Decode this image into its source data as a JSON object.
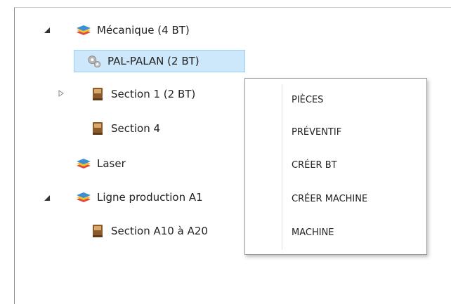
{
  "tree": {
    "nodes": [
      {
        "label": "Mécanique (4 BT)",
        "icon": "layers-icon",
        "expander": "expanded"
      },
      {
        "label": "PAL-PALAN (2 BT)",
        "icon": "gears-icon",
        "selected": true
      },
      {
        "label": "Section 1 (2 BT)",
        "icon": "book-icon",
        "expander": "collapsed"
      },
      {
        "label": "Section 4",
        "icon": "book-icon"
      },
      {
        "label": "Laser",
        "icon": "layers-icon"
      },
      {
        "label": "Ligne production A1",
        "icon": "layers-icon",
        "expander": "expanded"
      },
      {
        "label": "Section A10 à A20",
        "icon": "book-icon"
      }
    ]
  },
  "context_menu": {
    "items": [
      {
        "label": "PIÈCES"
      },
      {
        "label": "PRÉVENTIF"
      },
      {
        "label": "CRÉER BT"
      },
      {
        "label": "CRÉER MACHINE"
      },
      {
        "label": "MACHINE"
      }
    ]
  },
  "colors": {
    "selection_bg": "#cde8fb",
    "selection_border": "#99d1f5",
    "layer_blue": "#3a8fd6",
    "layer_yellow": "#f2c230",
    "layer_red": "#e2483a",
    "book_brown": "#8b5a2b"
  }
}
